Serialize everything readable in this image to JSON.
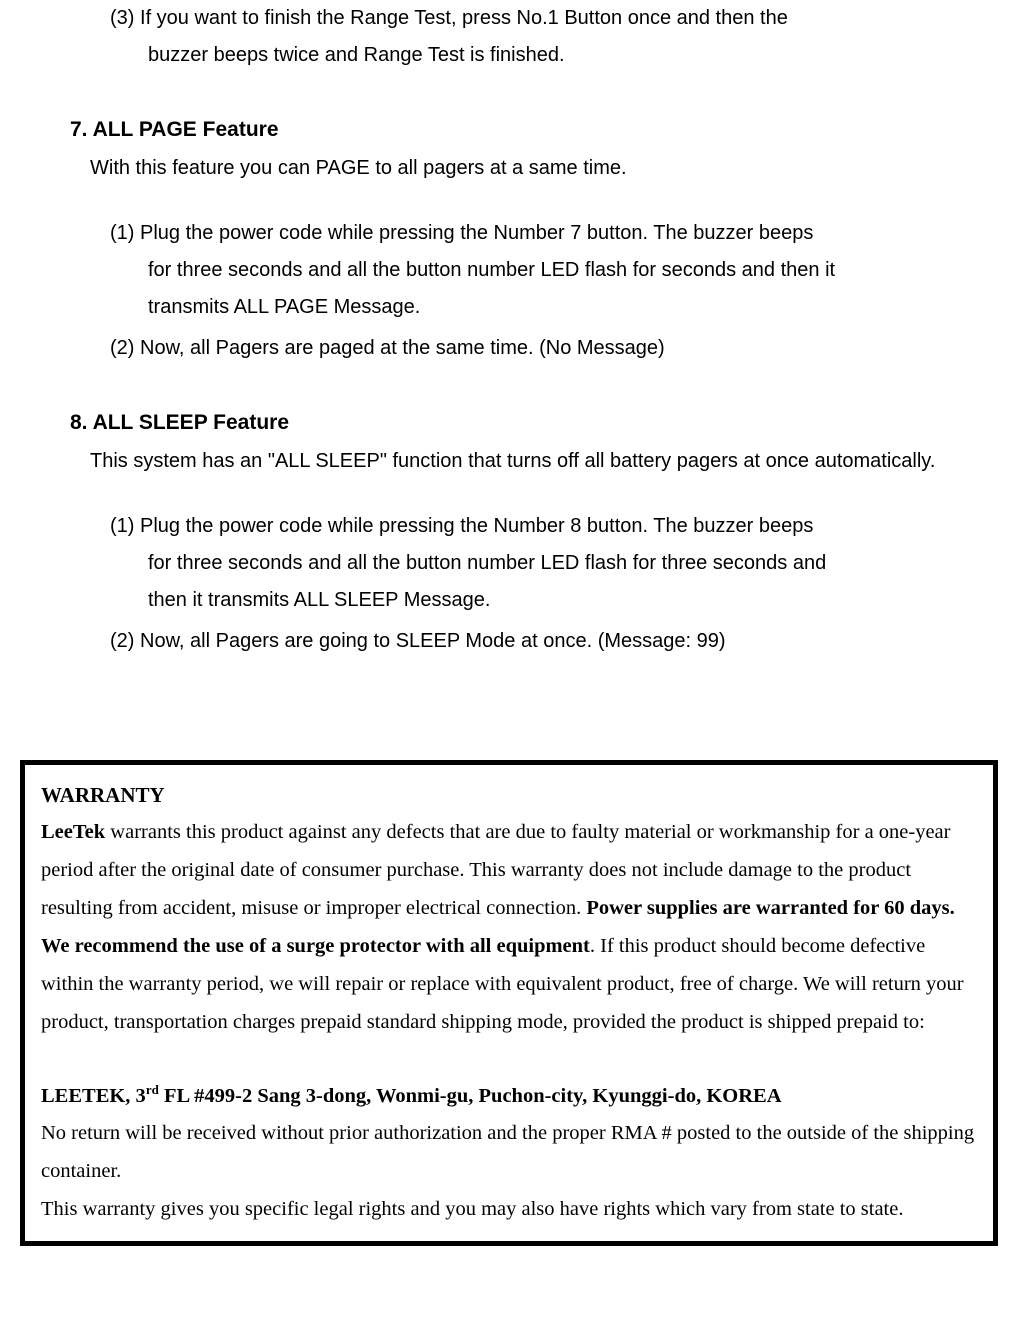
{
  "top_instruction": {
    "num": "(3)",
    "text_line1": "If you want to finish the Range Test, press No.1 Button once and then the",
    "text_line2": "buzzer beeps twice and Range Test is finished."
  },
  "section7": {
    "heading": "7. ALL PAGE Feature",
    "intro": "With this feature you can PAGE to all pagers at a same time.",
    "instructions": [
      {
        "num": "(1)",
        "line1": "Plug the power code while pressing the Number 7 button. The buzzer beeps",
        "line2": "for three seconds and all the button number LED flash for seconds and then it",
        "line3": "transmits ALL PAGE Message."
      },
      {
        "num": "(2)",
        "line1": "Now, all Pagers are paged at the same time. (No Message)"
      }
    ]
  },
  "section8": {
    "heading": "8. ALL SLEEP Feature",
    "intro": "This system has an \"ALL SLEEP\" function that turns off all battery pagers at once automatically.",
    "instructions": [
      {
        "num": "(1)",
        "line1": "Plug the power code while pressing the Number 8 button. The buzzer beeps",
        "line2": "for three seconds and all the button number LED flash for three seconds and",
        "line3": "then it transmits ALL SLEEP Message."
      },
      {
        "num": "(2)",
        "line1": "Now, all Pagers are going to SLEEP Mode at once. (Message: 99)"
      }
    ]
  },
  "warranty": {
    "title": "WARRANTY",
    "company": "LeeTek",
    "para1_start": " warrants this product against any defects that are due to faulty material or workmanship for a one-year period after the original date of consumer purchase. This warranty does not include damage to the product resulting from accident, misuse or improper electrical connection. ",
    "bold_part": "Power supplies are warranted for 60 days. We recommend the use of a surge protector with all equipment",
    "para1_end": ". If this product should become defective within the warranty period, we will repair or replace with equivalent product, free of charge. We will return your product, transportation charges prepaid standard shipping mode, provided the product is shipped prepaid to:",
    "address_pre": "LEETEK, 3",
    "address_sup": "rd",
    "address_post": " FL #499-2 Sang 3-dong, Wonmi-gu, Puchon-city, Kyunggi-do, KOREA",
    "para2": "No return will be received without prior authorization and the proper RMA # posted to the outside of the shipping container.",
    "para3": "This warranty gives you specific legal rights and you may also have rights which vary from state to state."
  }
}
